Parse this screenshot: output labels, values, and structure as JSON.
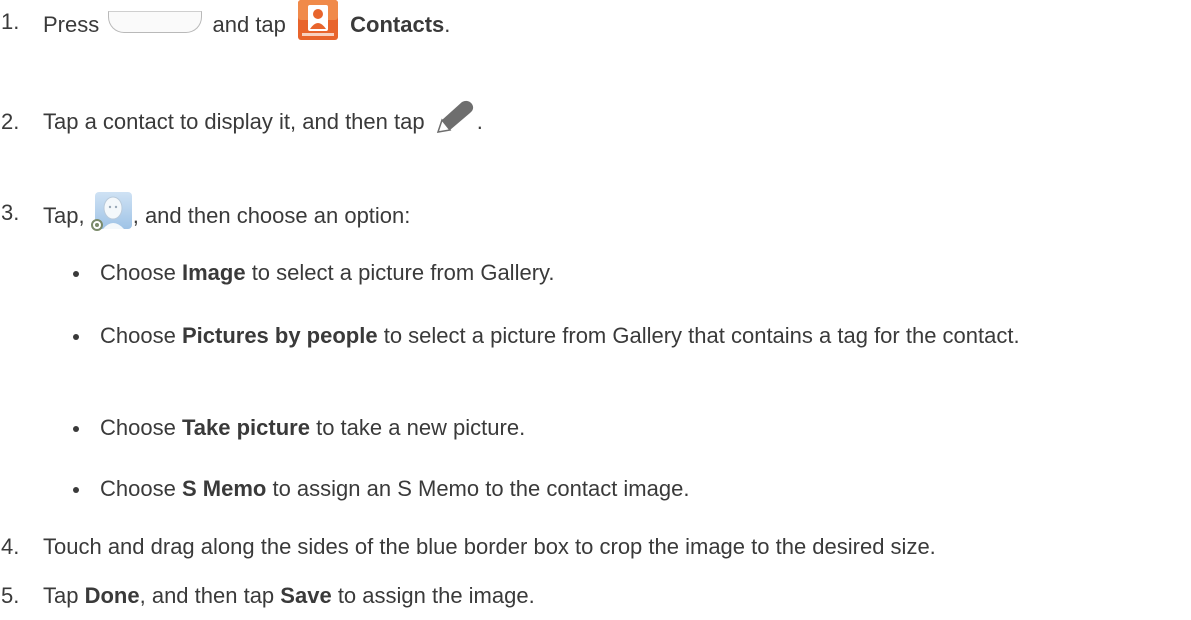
{
  "steps": [
    {
      "num": "1.",
      "pre": "Press",
      "mid": "and tap",
      "bold": "Contacts",
      "post": "."
    },
    {
      "num": "2.",
      "text": "Tap a contact to display it, and then tap",
      "post": "."
    },
    {
      "num": "3.",
      "pre": "Tap,",
      "post": ", and then choose an option:"
    },
    {
      "num": "4.",
      "text": "Touch and drag along the sides of the blue border box to crop the image to the desired size."
    },
    {
      "num": "5.",
      "pre": "Tap",
      "bold1": "Done",
      "mid": ", and then tap",
      "bold2": "Save",
      "post": "to assign the image."
    }
  ],
  "options": [
    {
      "pre": "Choose",
      "bold": "Image",
      "post": "to select a picture from Gallery."
    },
    {
      "pre": "Choose",
      "bold": "Pictures by people",
      "post": "to select a picture from Gallery that contains a tag for the contact."
    },
    {
      "pre": "Choose",
      "bold": "Take picture",
      "post": "to take a new picture."
    },
    {
      "pre": "Choose",
      "bold": "S Memo",
      "post": "to assign an S Memo to the contact image."
    }
  ],
  "icons": {
    "home_key": "home-key-icon",
    "contacts": "contacts-app-icon",
    "edit": "pencil-edit-icon",
    "photo": "contact-photo-icon"
  },
  "colors": {
    "text": "#3a3a3a",
    "contacts_icon_bg": "#e8642c",
    "pencil": "#6e6e6e"
  }
}
